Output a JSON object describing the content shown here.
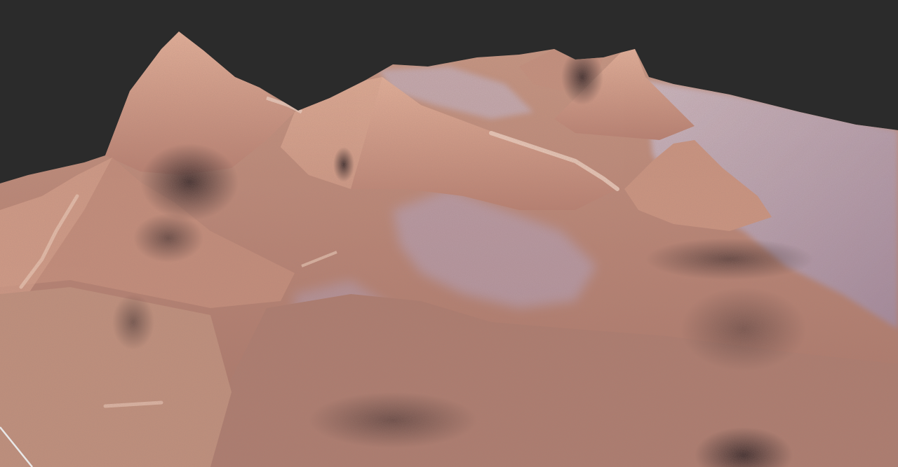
{
  "viewport": {
    "background_color": "#2b2b2b",
    "content": "3d-terrain-render"
  },
  "terrain": {
    "palette": {
      "rock_base": "#c08a78",
      "rock_light": "#d9a48f",
      "rock_peak": "#e3ad95",
      "rock_shadow": "#5a3f3c",
      "snow_lavender": "#b8aac4",
      "snow_highlight": "#cfc6d8",
      "deep_shadow": "#3a2c2e"
    },
    "features": [
      "peak",
      "peak",
      "peak",
      "peak",
      "peak",
      "peak",
      "ridge",
      "valley",
      "plateau"
    ]
  },
  "overlay": {
    "corner_edge_color": "#e8e8e8"
  }
}
